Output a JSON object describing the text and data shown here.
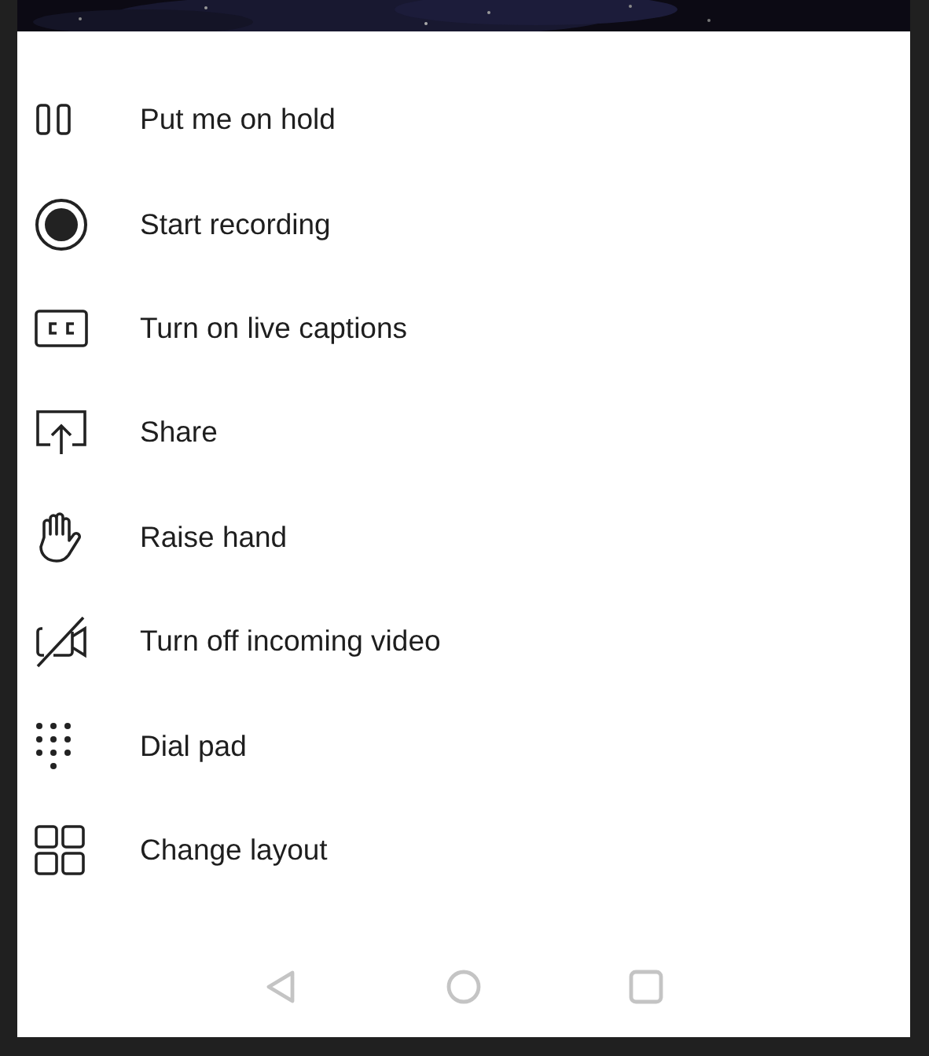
{
  "menu": {
    "items": [
      {
        "kind": "hold",
        "label": "Put me on hold"
      },
      {
        "kind": "record",
        "label": "Start recording"
      },
      {
        "kind": "captions",
        "label": "Turn on live captions"
      },
      {
        "kind": "share",
        "label": "Share"
      },
      {
        "kind": "hand",
        "label": "Raise hand"
      },
      {
        "kind": "video-off",
        "label": "Turn off incoming video"
      },
      {
        "kind": "dialpad",
        "label": "Dial pad"
      },
      {
        "kind": "layout",
        "label": "Change layout"
      }
    ]
  }
}
